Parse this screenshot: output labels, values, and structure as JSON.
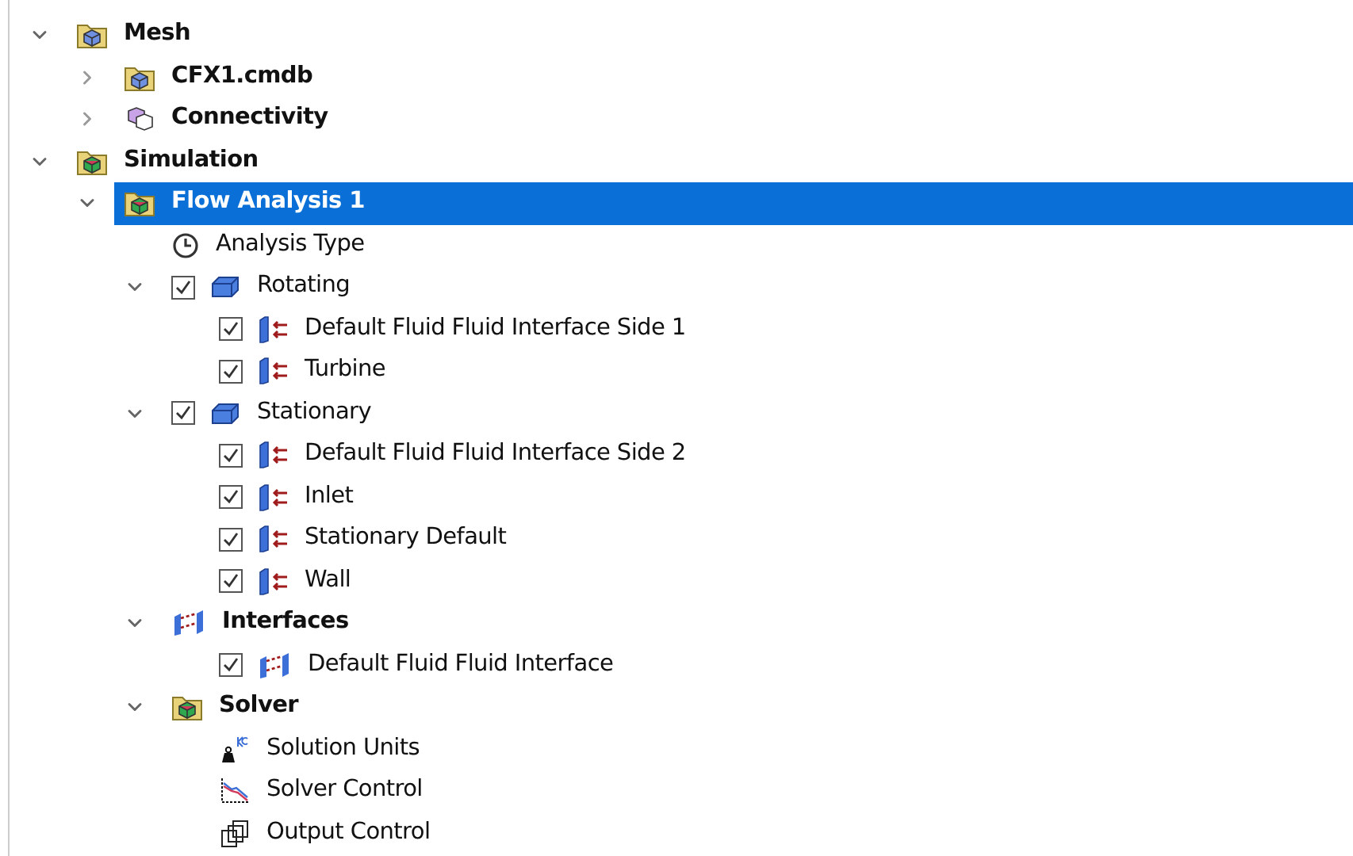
{
  "tree": [
    {
      "label": "Mesh",
      "bold": true,
      "kind": "mesh-folder",
      "expanded": true,
      "selected": false,
      "children": [
        {
          "label": "CFX1.cmdb",
          "bold": true,
          "kind": "mesh-folder",
          "expanded": false,
          "selected": false
        },
        {
          "label": "Connectivity",
          "bold": true,
          "kind": "connectivity",
          "expanded": false,
          "selected": false
        }
      ]
    },
    {
      "label": "Simulation",
      "bold": true,
      "kind": "sim-folder",
      "expanded": true,
      "selected": false,
      "children": [
        {
          "label": "Flow Analysis 1",
          "bold": true,
          "kind": "sim-folder",
          "expanded": true,
          "selected": true,
          "children": [
            {
              "label": "Analysis Type",
              "bold": false,
              "kind": "clock",
              "selected": false
            },
            {
              "label": "Rotating",
              "bold": false,
              "kind": "domain",
              "checked": true,
              "expanded": true,
              "selected": false,
              "children": [
                {
                  "label": "Default Fluid Fluid Interface Side 1",
                  "bold": false,
                  "kind": "boundary",
                  "checked": true,
                  "selected": false
                },
                {
                  "label": "Turbine",
                  "bold": false,
                  "kind": "boundary",
                  "checked": true,
                  "selected": false
                }
              ]
            },
            {
              "label": "Stationary",
              "bold": false,
              "kind": "domain",
              "checked": true,
              "expanded": true,
              "selected": false,
              "children": [
                {
                  "label": "Default Fluid Fluid Interface Side 2",
                  "bold": false,
                  "kind": "boundary",
                  "checked": true,
                  "selected": false
                },
                {
                  "label": "Inlet",
                  "bold": false,
                  "kind": "boundary",
                  "checked": true,
                  "selected": false
                },
                {
                  "label": "Stationary Default",
                  "bold": false,
                  "kind": "boundary",
                  "checked": true,
                  "selected": false
                },
                {
                  "label": "Wall",
                  "bold": false,
                  "kind": "boundary",
                  "checked": true,
                  "selected": false
                }
              ]
            },
            {
              "label": "Interfaces",
              "bold": true,
              "kind": "interface",
              "expanded": true,
              "selected": false,
              "children": [
                {
                  "label": "Default Fluid Fluid Interface",
                  "bold": false,
                  "kind": "interface",
                  "checked": true,
                  "selected": false
                }
              ]
            },
            {
              "label": "Solver",
              "bold": true,
              "kind": "sim-folder",
              "expanded": true,
              "selected": false,
              "children": [
                {
                  "label": "Solution Units",
                  "bold": false,
                  "kind": "units",
                  "selected": false
                },
                {
                  "label": "Solver Control",
                  "bold": false,
                  "kind": "solver-control",
                  "selected": false
                },
                {
                  "label": "Output Control",
                  "bold": false,
                  "kind": "output-control",
                  "selected": false
                }
              ]
            }
          ]
        }
      ]
    }
  ]
}
